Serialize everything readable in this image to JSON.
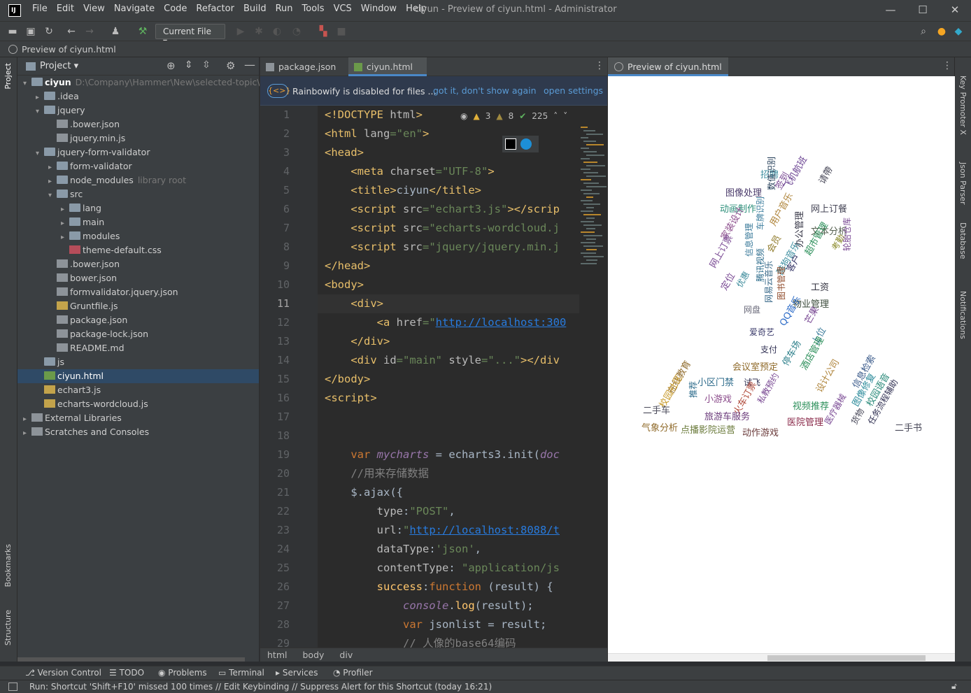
{
  "window": {
    "logo": "IJ",
    "menus": [
      "File",
      "Edit",
      "View",
      "Navigate",
      "Code",
      "Refactor",
      "Build",
      "Run",
      "Tools",
      "VCS",
      "Window",
      "Help"
    ],
    "title": "ciyun - Preview of ciyun.html - Administrator",
    "controls": [
      "—",
      "☐",
      "✕"
    ]
  },
  "toolbar": {
    "run_config": "Current File ▾"
  },
  "navbar": {
    "title": "Preview of ciyun.html"
  },
  "left_strip": {
    "project": "Project",
    "bookmarks": "Bookmarks",
    "structure": "Structure"
  },
  "right_strip": {
    "key_promoter": "Key Promoter X",
    "json_parser": "Json Parser",
    "database": "Database",
    "notifications": "Notifications"
  },
  "project": {
    "header": "Project ▾",
    "tree": [
      {
        "label": "ciyun",
        "hint": "D:\\Company\\Hammer\\New\\selected-topic\\ci",
        "type": "folder",
        "depth": 0,
        "expanded": true,
        "bold": true
      },
      {
        "label": ".idea",
        "hint": "",
        "type": "folder",
        "depth": 1,
        "expanded": false
      },
      {
        "label": "jquery",
        "hint": "",
        "type": "folder",
        "depth": 1,
        "expanded": true
      },
      {
        "label": ".bower.json",
        "hint": "",
        "type": "file",
        "depth": 2
      },
      {
        "label": "jquery.min.js",
        "hint": "",
        "type": "file",
        "depth": 2
      },
      {
        "label": "jquery-form-validator",
        "hint": "",
        "type": "folder",
        "depth": 1,
        "expanded": true
      },
      {
        "label": "form-validator",
        "hint": "",
        "type": "folder",
        "depth": 2,
        "expanded": false
      },
      {
        "label": "node_modules",
        "hint": "library root",
        "type": "folder",
        "depth": 2,
        "expanded": false
      },
      {
        "label": "src",
        "hint": "",
        "type": "folder",
        "depth": 2,
        "expanded": true
      },
      {
        "label": "lang",
        "hint": "",
        "type": "folder",
        "depth": 3,
        "expanded": false
      },
      {
        "label": "main",
        "hint": "",
        "type": "folder",
        "depth": 3,
        "expanded": false
      },
      {
        "label": "modules",
        "hint": "",
        "type": "folder",
        "depth": 3,
        "expanded": false
      },
      {
        "label": "theme-default.css",
        "hint": "",
        "type": "css",
        "depth": 3
      },
      {
        "label": ".bower.json",
        "hint": "",
        "type": "file",
        "depth": 2
      },
      {
        "label": "bower.json",
        "hint": "",
        "type": "file",
        "depth": 2
      },
      {
        "label": "formvalidator.jquery.json",
        "hint": "",
        "type": "file",
        "depth": 2
      },
      {
        "label": "Gruntfile.js",
        "hint": "",
        "type": "js",
        "depth": 2
      },
      {
        "label": "package.json",
        "hint": "",
        "type": "file",
        "depth": 2
      },
      {
        "label": "package-lock.json",
        "hint": "",
        "type": "file",
        "depth": 2
      },
      {
        "label": "README.md",
        "hint": "",
        "type": "file",
        "depth": 2
      },
      {
        "label": "js",
        "hint": "",
        "type": "folder",
        "depth": 1
      },
      {
        "label": "ciyun.html",
        "hint": "",
        "type": "html",
        "depth": 1,
        "selected": true
      },
      {
        "label": "echart3.js",
        "hint": "",
        "type": "js",
        "depth": 1
      },
      {
        "label": "echarts-wordcloud.js",
        "hint": "",
        "type": "js",
        "depth": 1
      },
      {
        "label": "External Libraries",
        "hint": "",
        "type": "lib",
        "depth": 0,
        "expanded": false
      },
      {
        "label": "Scratches and Consoles",
        "hint": "",
        "type": "scratch",
        "depth": 0,
        "expanded": false
      }
    ]
  },
  "editor": {
    "tabs": [
      "package.json",
      "ciyun.html"
    ],
    "banner": {
      "text": "Rainbowify is disabled for files ...",
      "link1": "got it, don't show again",
      "link2": "open settings"
    },
    "inspections": {
      "warnings": "3",
      "weak": "8",
      "ok": "225"
    },
    "line_numbers": [
      "1",
      "2",
      "3",
      "4",
      "5",
      "6",
      "7",
      "8",
      "9",
      "10",
      "11",
      "12",
      "13",
      "14",
      "15",
      "16",
      "17",
      "18",
      "19",
      "20",
      "21",
      "22",
      "23",
      "24",
      "25",
      "26",
      "27",
      "28",
      "29"
    ],
    "lines": [
      [
        [
          "tag",
          "<!DOCTYPE "
        ],
        [
          "attr",
          "html"
        ],
        [
          "tag",
          ">"
        ]
      ],
      [
        [
          "tag",
          "<html "
        ],
        [
          "attr",
          "lang"
        ],
        [
          "str",
          "=\"en\""
        ],
        [
          "tag",
          ">"
        ]
      ],
      [
        [
          "tag",
          "<head>"
        ]
      ],
      [
        [
          "sp",
          "    "
        ],
        [
          "tag",
          "<meta "
        ],
        [
          "attr",
          "charset"
        ],
        [
          "str",
          "=\"UTF-8\""
        ],
        [
          "tag",
          ">"
        ]
      ],
      [
        [
          "sp",
          "    "
        ],
        [
          "tag",
          "<title>"
        ],
        [
          "pl",
          "ciyun"
        ],
        [
          "tag",
          "</title>"
        ]
      ],
      [
        [
          "sp",
          "    "
        ],
        [
          "tag",
          "<script "
        ],
        [
          "attr",
          "src"
        ],
        [
          "str",
          "=\"echart3.js\""
        ],
        [
          "tag",
          "></scrip"
        ]
      ],
      [
        [
          "sp",
          "    "
        ],
        [
          "tag",
          "<script "
        ],
        [
          "attr",
          "src"
        ],
        [
          "str",
          "=\"echarts-wordcloud.j"
        ]
      ],
      [
        [
          "sp",
          "    "
        ],
        [
          "tag",
          "<script "
        ],
        [
          "attr",
          "src"
        ],
        [
          "str",
          "=\"jquery/jquery.min.j"
        ]
      ],
      [
        [
          "tag",
          "</head>"
        ]
      ],
      [
        [
          "tag",
          "<body>"
        ]
      ],
      [
        [
          "sp",
          "    "
        ],
        [
          "tag",
          "<div>"
        ]
      ],
      [
        [
          "sp",
          "        "
        ],
        [
          "tag",
          "<a "
        ],
        [
          "attr",
          "href"
        ],
        [
          "str",
          "=\""
        ],
        [
          "url",
          "http://localhost:300"
        ]
      ],
      [
        [
          "sp",
          "    "
        ],
        [
          "tag",
          "</div>"
        ]
      ],
      [
        [
          "sp",
          "    "
        ],
        [
          "tag",
          "<div "
        ],
        [
          "attr",
          "id"
        ],
        [
          "str",
          "=\"main\" "
        ],
        [
          "attr",
          "style"
        ],
        [
          "str",
          "=\"...\""
        ],
        [
          "tag",
          "></div"
        ]
      ],
      [
        [
          "tag",
          "</body>"
        ]
      ],
      [
        [
          "tag",
          "<script>"
        ]
      ],
      [
        [
          "pl",
          ""
        ]
      ],
      [
        [
          "pl",
          ""
        ]
      ],
      [
        [
          "sp",
          "    "
        ],
        [
          "kw",
          "var "
        ],
        [
          "it",
          "mycharts"
        ],
        [
          "pl",
          " = "
        ],
        [
          "pl",
          "echarts3.init("
        ],
        [
          "it",
          "doc"
        ]
      ],
      [
        [
          "sp",
          "    "
        ],
        [
          "cm",
          "//用来存储数据"
        ]
      ],
      [
        [
          "sp",
          "    "
        ],
        [
          "pl",
          "$.ajax({"
        ]
      ],
      [
        [
          "sp",
          "        "
        ],
        [
          "attr",
          "type"
        ],
        [
          "pl",
          ":"
        ],
        [
          "str",
          "\"POST\""
        ],
        [
          "pl",
          ","
        ]
      ],
      [
        [
          "sp",
          "        "
        ],
        [
          "attr",
          "url"
        ],
        [
          "pl",
          ":"
        ],
        [
          "str",
          "\""
        ],
        [
          "url",
          "http://localhost:8088/t"
        ]
      ],
      [
        [
          "sp",
          "        "
        ],
        [
          "attr",
          "dataType"
        ],
        [
          "pl",
          ":"
        ],
        [
          "str",
          "'json'"
        ],
        [
          "pl",
          ","
        ]
      ],
      [
        [
          "sp",
          "        "
        ],
        [
          "attr",
          "contentType"
        ],
        [
          "pl",
          ": "
        ],
        [
          "str",
          "\"application/js"
        ]
      ],
      [
        [
          "sp",
          "        "
        ],
        [
          "fn",
          "success"
        ],
        [
          "pl",
          ":"
        ],
        [
          "kw",
          "function "
        ],
        [
          "pl",
          "(result) {"
        ]
      ],
      [
        [
          "sp",
          "            "
        ],
        [
          "it",
          "console"
        ],
        [
          "pl",
          "."
        ],
        [
          "fn",
          "log"
        ],
        [
          "pl",
          "(result);"
        ]
      ],
      [
        [
          "sp",
          "            "
        ],
        [
          "kw",
          "var "
        ],
        [
          "pl",
          "jsonlist = result;"
        ]
      ],
      [
        [
          "sp",
          "            "
        ],
        [
          "cm",
          "// 人像的base64编码"
        ]
      ]
    ],
    "breadcrumb": [
      "html",
      "body",
      "div"
    ]
  },
  "preview": {
    "tab": "Preview of ciyun.html",
    "words": [
      {
        "t": "招聘",
        "c": "#3f8fa1",
        "r": 0
      },
      {
        "t": "签到",
        "c": "#7a4a94",
        "r": -60
      },
      {
        "t": "图像处理",
        "c": "#4a3a6a",
        "r": 0
      },
      {
        "t": "数值识别",
        "c": "#253f59",
        "r": -90
      },
      {
        "t": "飞机航班",
        "c": "#6a4292",
        "r": -60
      },
      {
        "t": "请帶",
        "c": "#4a4a5a",
        "r": -60
      },
      {
        "t": "动画制作",
        "c": "#2c8f7a",
        "r": 0
      },
      {
        "t": "网上订餐",
        "c": "#444455",
        "r": 0
      },
      {
        "t": "用户音乐",
        "c": "#b0863d",
        "r": -60
      },
      {
        "t": "车牌识别",
        "c": "#3f7f9f",
        "r": -90
      },
      {
        "t": "家装设计",
        "c": "#8a4a8a",
        "r": -60
      },
      {
        "t": "文本分析",
        "c": "#556050",
        "r": 0
      },
      {
        "t": "办公管理",
        "c": "#3a3a4a",
        "r": -90
      },
      {
        "t": "超市管理",
        "c": "#2c8f5a",
        "r": -60
      },
      {
        "t": "考勤",
        "c": "#8a8a2a",
        "r": -60
      },
      {
        "t": "轮胎仓库",
        "c": "#7a4a94",
        "r": -90
      },
      {
        "t": "信息管理",
        "c": "#3a7a9a",
        "r": -90
      },
      {
        "t": "会员",
        "c": "#8f7a2a",
        "r": -60
      },
      {
        "t": "网上订票",
        "c": "#7a4a94",
        "r": -60
      },
      {
        "t": "酷狗音乐",
        "c": "#3f8fa1",
        "r": -60
      },
      {
        "t": "客户",
        "c": "#3a3a6a",
        "r": -60
      },
      {
        "t": "工资",
        "c": "#333340",
        "r": 0
      },
      {
        "t": "腾讯视频",
        "c": "#2a6a8a",
        "r": -90
      },
      {
        "t": "定位",
        "c": "#7a4a94",
        "r": -60
      },
      {
        "t": "优惠",
        "c": "#3a8a9a",
        "r": -60
      },
      {
        "t": "网易云音乐",
        "c": "#3a6a8a",
        "r": -90
      },
      {
        "t": "图书管理",
        "c": "#8f4a2a",
        "r": -90
      },
      {
        "t": "物业管理",
        "c": "#3a4a3a",
        "r": 0
      },
      {
        "t": "网盘",
        "c": "#6a6a7a",
        "r": 0
      },
      {
        "t": "QQ音乐",
        "c": "#2a6ac7",
        "r": -60
      },
      {
        "t": "芒果",
        "c": "#7a4a94",
        "r": -60
      },
      {
        "t": "爱奇艺",
        "c": "#3a3a6a",
        "r": 0
      },
      {
        "t": "上位",
        "c": "#3a7a9a",
        "r": -60
      },
      {
        "t": "支付",
        "c": "#333355",
        "r": 0
      },
      {
        "t": "停车场",
        "c": "#2c7f8a",
        "r": -60
      },
      {
        "t": "会议室预定",
        "c": "#8f6a2a",
        "r": 0
      },
      {
        "t": "酒店管理",
        "c": "#2c8f5a",
        "r": -60
      },
      {
        "t": "在线教育",
        "c": "#8f6a2a",
        "r": -60
      },
      {
        "t": "小区门禁",
        "c": "#2c6a8a",
        "r": 0
      },
      {
        "t": "试飞",
        "c": "#333355",
        "r": 0
      },
      {
        "t": "设计公司",
        "c": "#b0863d",
        "r": -60
      },
      {
        "t": "信息检索",
        "c": "#3a5a8a",
        "r": -60
      },
      {
        "t": "校园社区",
        "c": "#c79a2a",
        "r": -60
      },
      {
        "t": "推荐",
        "c": "#2a6a8a",
        "r": -90
      },
      {
        "t": "小游戏",
        "c": "#8a4a8a",
        "r": 0
      },
      {
        "t": "私教预约",
        "c": "#7a4a94",
        "r": -60
      },
      {
        "t": "图像修复",
        "c": "#2a8a9a",
        "r": -60
      },
      {
        "t": "校园语音",
        "c": "#2a8a7a",
        "r": -60
      },
      {
        "t": "二手车",
        "c": "#4a4a5a",
        "r": 0
      },
      {
        "t": "火车订票",
        "c": "#b04a3a",
        "r": -60
      },
      {
        "t": "视频推荐",
        "c": "#2c8f5a",
        "r": 0
      },
      {
        "t": "旅游车服务",
        "c": "#6a3a7a",
        "r": 0
      },
      {
        "t": "医疗器械",
        "c": "#7a4a94",
        "r": -60
      },
      {
        "t": "货物",
        "c": "#444455",
        "r": -60
      },
      {
        "t": "任务流程辅助",
        "c": "#333355",
        "r": -60
      },
      {
        "t": "医院管理",
        "c": "#8a2a4a",
        "r": 0
      },
      {
        "t": "气象分析",
        "c": "#8f6a2a",
        "r": 0
      },
      {
        "t": "点播影院运营",
        "c": "#6a7a3a",
        "r": 0
      },
      {
        "t": "动作游戏",
        "c": "#6a3a3a",
        "r": 0
      },
      {
        "t": "二手书",
        "c": "#4a4a5a",
        "r": 0
      }
    ]
  },
  "toolwindows": [
    "Version Control",
    "TODO",
    "Problems",
    "Terminal",
    "Services",
    "Profiler"
  ],
  "status": {
    "text": "Run: Shortcut 'Shift+F10' missed 100 times // Edit Keybinding // Suppress Alert for this Shortcut (today 16:21)"
  }
}
